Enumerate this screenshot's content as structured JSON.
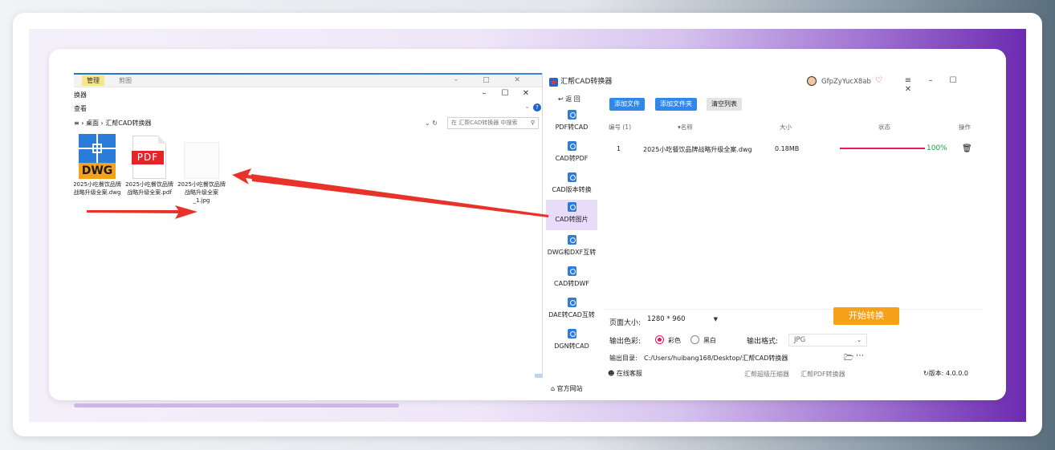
{
  "explorer": {
    "tab_manage": "管理",
    "tab_back_label": "剪图",
    "title": "换器",
    "view_menu": "查看",
    "breadcrumb": "≡  ›  桌面  ›  汇帮CAD转换器",
    "search_placeholder": "在 汇帮CAD转换器 中搜索",
    "files": [
      {
        "icon": "dwg-file-icon",
        "icon_text": "DWG",
        "name": "2025小吃餐饮品牌战略升级全案.dwg"
      },
      {
        "icon": "pdf-file-icon",
        "icon_text": "PDF",
        "name": "2025小吃餐饮品牌战略升级全案.pdf"
      },
      {
        "icon": "jpg-file-icon",
        "icon_text": "",
        "name": "2025小吃餐饮品牌战略升级全案_1.jpg"
      }
    ]
  },
  "app": {
    "title": "汇帮CAD转换器",
    "username": "GfpZyYucX8ab",
    "back": "返 回",
    "sidebar": [
      {
        "label": "PDF转CAD",
        "active": false
      },
      {
        "label": "CAD转PDF",
        "active": false
      },
      {
        "label": "CAD版本转换",
        "active": false
      },
      {
        "label": "CAD转图片",
        "active": true
      },
      {
        "label": "DWG和DXF互转",
        "active": false
      },
      {
        "label": "CAD转DWF",
        "active": false
      },
      {
        "label": "DAE转CAD互转",
        "active": false
      },
      {
        "label": "DGN转CAD",
        "active": false
      }
    ],
    "official_site": "官方网站",
    "toolbar": {
      "add_file": "添加文件",
      "add_folder": "添加文件夹",
      "clear_list": "清空列表"
    },
    "table": {
      "headers": {
        "index": "编号 (1)",
        "name": "名称",
        "size": "大小",
        "status": "状态",
        "action": "操作"
      },
      "rows": [
        {
          "index": "1",
          "name": "2025小吃餐饮品牌战略升级全案.dwg",
          "size": "0.18MB",
          "progress": 1.0,
          "progress_label": "100%"
        }
      ]
    },
    "settings": {
      "page_size_label": "页面大小:",
      "page_size_value": "1280 * 960",
      "color_label": "输出色彩:",
      "color_option": "彩色",
      "bw_option": "黑白",
      "color_selected": "color",
      "format_label": "输出格式:",
      "format_value": "JPG",
      "dir_label": "输出目录:",
      "dir_value": "C:/Users/huibang168/Desktop/汇帮CAD转换器",
      "start_button": "开始转换"
    },
    "footer": {
      "online_service": "在线客服",
      "compressor_link": "汇帮超级压缩器",
      "pdf_converter_link": "汇帮PDF转换器",
      "version": "版本: 4.0.0.0"
    }
  },
  "colors": {
    "accent": "#2f88ea",
    "progress": "#e8185c",
    "start_button": "#f7a11a",
    "arrow": "#e8322a"
  }
}
